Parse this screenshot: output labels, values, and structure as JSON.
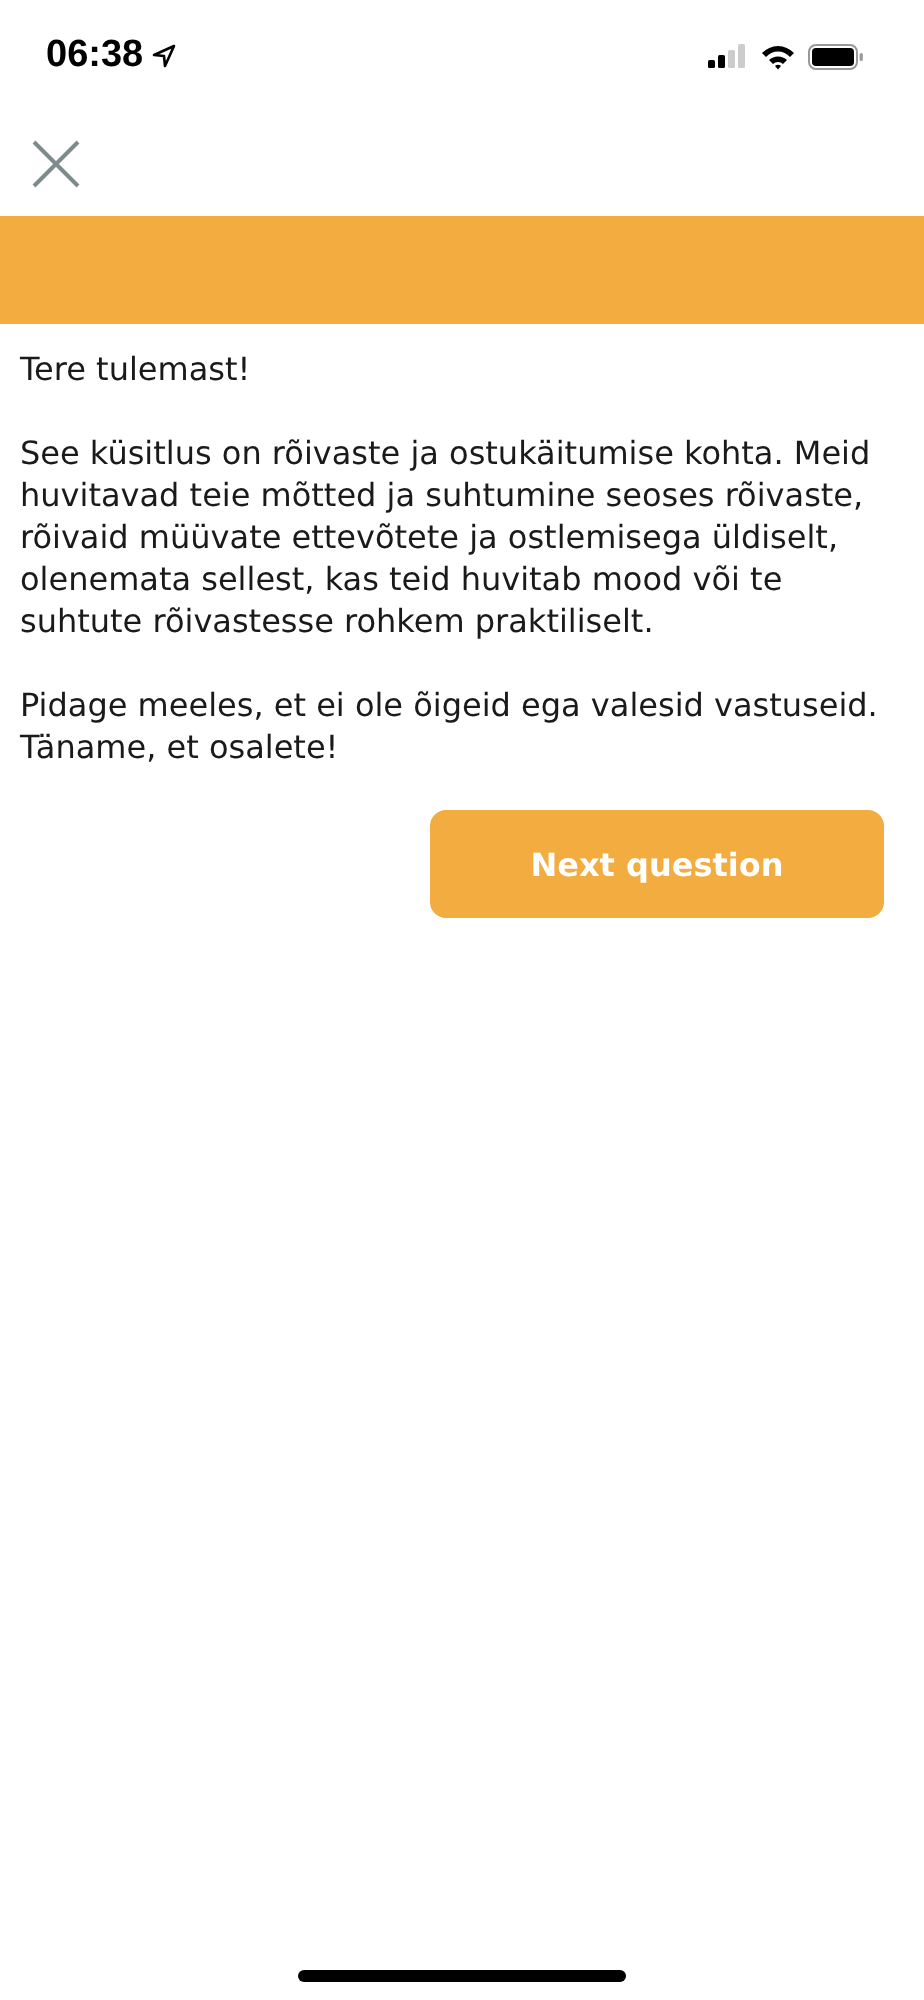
{
  "status_bar": {
    "time": "06:38"
  },
  "paragraphs": [
    "Tere tulemast!",
    "See küsitlus on rõivaste ja ostukäitumise kohta. Meid huvitavad teie mõtted ja suhtumine seoses rõivaste, rõivaid müüvate ettevõtete ja ostlemisega üldiselt, olenemata sellest, kas teid huvitab mood või te suhtute rõivastesse rohkem praktiliselt.",
    "Pidage meeles, et ei ole õigeid ega valesid vastuseid. Täname, et osalete!"
  ],
  "next_button": {
    "label": "Next question"
  }
}
